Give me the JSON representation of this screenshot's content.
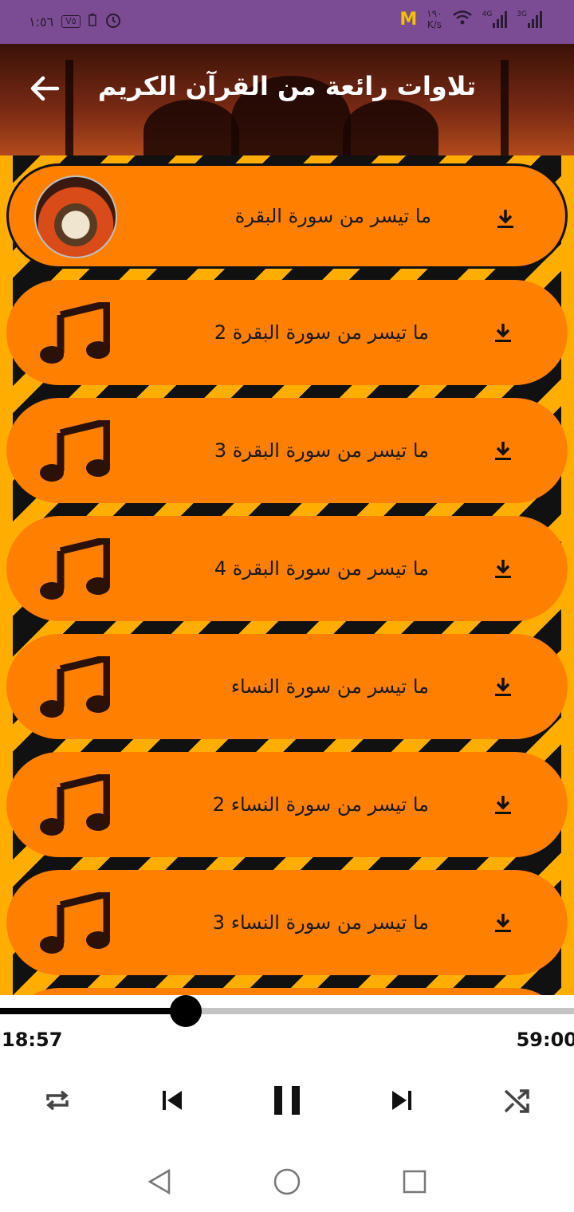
{
  "status_bar": {
    "time": "١:٥٦",
    "vo_badge": "V٥",
    "speed_value": "١٩٠",
    "speed_unit": "K/s",
    "net_4g": "4G",
    "net_3g": "3G",
    "app_badge": "M"
  },
  "header": {
    "title": "تلاوات رائعة من القرآن الكريم",
    "back_icon": "arrow-left-icon"
  },
  "colors": {
    "status_bar": "#7b4c93",
    "item_bg": "#ff7f00",
    "stripe_yellow": "#ffae00",
    "stripe_black": "#111111"
  },
  "tracks": [
    {
      "title": "ما تيسر من سورة البقرة",
      "icon": "reciter-avatar",
      "active": true
    },
    {
      "title": "ما تيسر من سورة البقرة 2",
      "icon": "music-note-icon",
      "active": false
    },
    {
      "title": "ما تيسر من سورة البقرة 3",
      "icon": "music-note-icon",
      "active": false
    },
    {
      "title": "ما تيسر من سورة البقرة 4",
      "icon": "music-note-icon",
      "active": false
    },
    {
      "title": "ما تيسر من سورة النساء",
      "icon": "music-note-icon",
      "active": false
    },
    {
      "title": "ما تيسر من سورة النساء 2",
      "icon": "music-note-icon",
      "active": false
    },
    {
      "title": "ما تيسر من سورة النساء 3",
      "icon": "music-note-icon",
      "active": false
    }
  ],
  "player": {
    "current_time": "18:57",
    "total_time": "59:00",
    "progress": 0.324,
    "controls": [
      "repeat-icon",
      "skip-previous-icon",
      "pause-icon",
      "skip-next-icon",
      "shuffle-icon"
    ]
  },
  "navbar": {
    "buttons": [
      "back-triangle-icon",
      "home-circle-icon",
      "recents-square-icon"
    ]
  }
}
